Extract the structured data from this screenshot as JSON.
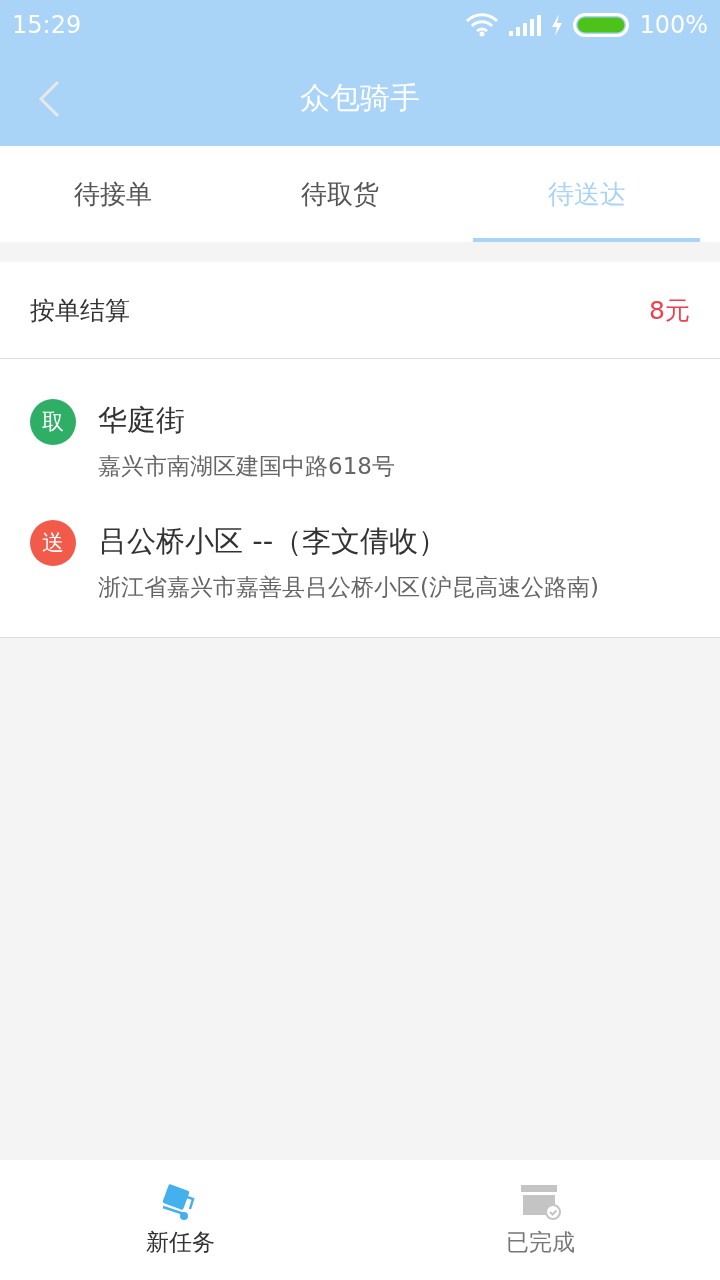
{
  "status_bar": {
    "time": "15:29",
    "battery": "100%"
  },
  "header": {
    "title": "众包骑手"
  },
  "tabs": [
    {
      "label": "待接单",
      "selected": false
    },
    {
      "label": "待取货",
      "selected": false
    },
    {
      "label": "待送达",
      "selected": true
    }
  ],
  "order": {
    "settlement_label": "按单结算",
    "fee": "8元",
    "stops": [
      {
        "badge": "取",
        "color": "#2fae66",
        "name": "华庭街",
        "address": "嘉兴市南湖区建国中路618号"
      },
      {
        "badge": "送",
        "color": "#f25a4a",
        "name": "吕公桥小区 --（李文倩收）",
        "address": "浙江省嘉兴市嘉善县吕公桥小区(沪昆高速公路南)"
      }
    ]
  },
  "bottom_nav": [
    {
      "kind": "tasks",
      "label": "新任务",
      "selected": true
    },
    {
      "kind": "done",
      "label": "已完成",
      "selected": false
    }
  ]
}
